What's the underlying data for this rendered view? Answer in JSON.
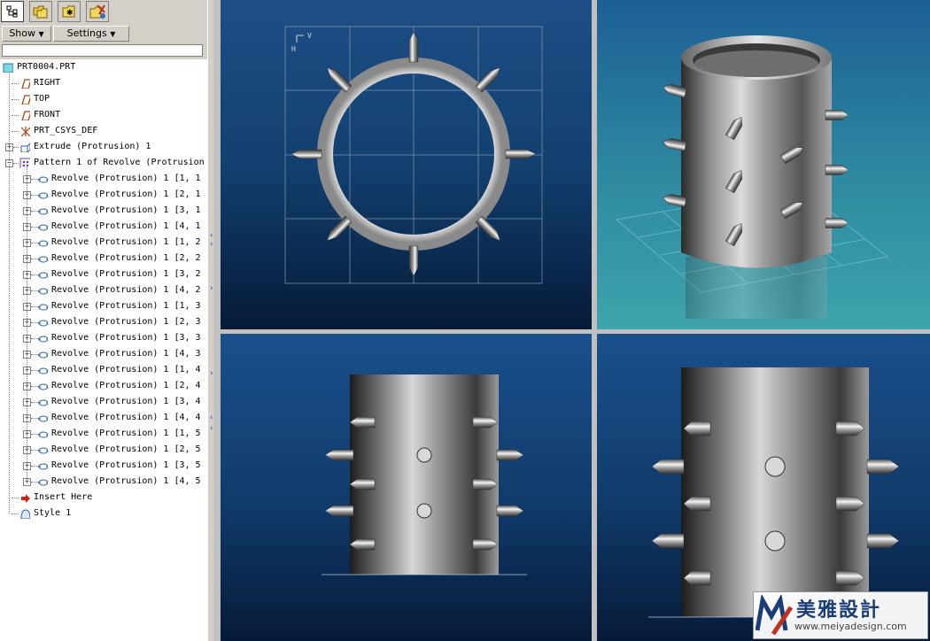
{
  "toolbar": {
    "tabs": [
      {
        "icon": "model-tree-icon"
      },
      {
        "icon": "folder-browser-icon"
      },
      {
        "icon": "favorites-folder-icon"
      },
      {
        "icon": "connections-icon"
      }
    ],
    "menus": [
      {
        "label": "Show",
        "arrow": "▼"
      },
      {
        "label": "Settings",
        "arrow": "▼"
      }
    ]
  },
  "model_tree": {
    "root": "PRT0004.PRT",
    "datums": [
      "RIGHT",
      "TOP",
      "FRONT"
    ],
    "csys": "PRT_CSYS_DEF",
    "extrude": "Extrude (Protrusion) 1",
    "pattern": "Pattern 1 of Revolve (Protrusion",
    "pattern_items": [
      "Revolve (Protrusion) 1 [1, 1",
      "Revolve (Protrusion) 1 [2, 1",
      "Revolve (Protrusion) 1 [3, 1",
      "Revolve (Protrusion) 1 [4, 1",
      "Revolve (Protrusion) 1 [1, 2",
      "Revolve (Protrusion) 1 [2, 2",
      "Revolve (Protrusion) 1 [3, 2",
      "Revolve (Protrusion) 1 [4, 2",
      "Revolve (Protrusion) 1 [1, 3",
      "Revolve (Protrusion) 1 [2, 3",
      "Revolve (Protrusion) 1 [3, 3",
      "Revolve (Protrusion) 1 [4, 3",
      "Revolve (Protrusion) 1 [1, 4",
      "Revolve (Protrusion) 1 [2, 4",
      "Revolve (Protrusion) 1 [3, 4",
      "Revolve (Protrusion) 1 [4, 4",
      "Revolve (Protrusion) 1 [1, 5",
      "Revolve (Protrusion) 1 [2, 5",
      "Revolve (Protrusion) 1 [3, 5",
      "Revolve (Protrusion) 1 [4, 5"
    ],
    "insert_here": "Insert Here",
    "style": "Style 1"
  },
  "viewports": {
    "top_view_axis_label": "H",
    "top_view_axis_label2": "V"
  },
  "watermark": {
    "name": "美雅設計",
    "url": "www.meiyadesign.com"
  },
  "colors": {
    "panel_bg": "#d4d0c8",
    "viewport_blue": "#12406f",
    "viewport_teal": "#3ea4ac",
    "accent": "#1a3c78"
  }
}
